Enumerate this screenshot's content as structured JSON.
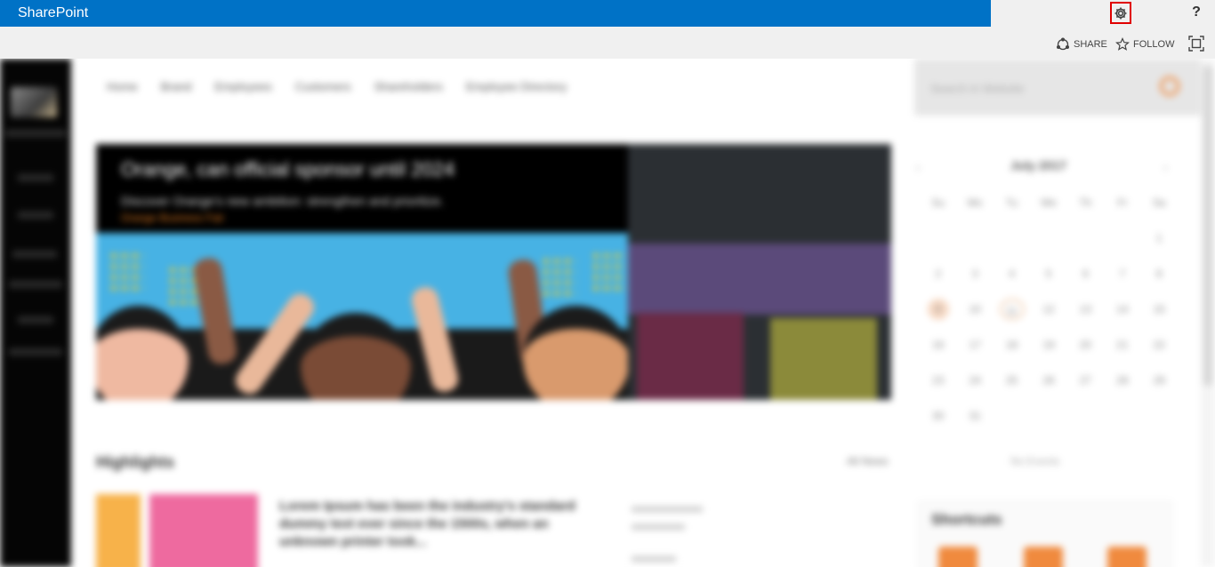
{
  "suite_bar": {
    "brand": "SharePoint",
    "help_label": "?"
  },
  "ribbon": {
    "share_label": "SHARE",
    "follow_label": "FOLLOW"
  },
  "nav": {
    "items": [
      "Home",
      "Brand",
      "Employees",
      "Customers",
      "Shareholders",
      "Employee Directory"
    ]
  },
  "hero": {
    "title": "Orange, can official sponsor until 2024",
    "subtitle": "Discover Orange's new ambition: strengthen and prioritize.",
    "link": "Orange Business Fair"
  },
  "highlights": {
    "title": "Highlights",
    "all_news": "All News",
    "card_text": "Lorem Ipsum has been the industry's standard dummy text ever since the 1500s, when an unknown printer took..."
  },
  "search": {
    "placeholder": "Search in Website"
  },
  "calendar": {
    "month": "July 2017",
    "weekdays": [
      "Su",
      "Mo",
      "Tu",
      "We",
      "Th",
      "Fr",
      "Sa"
    ],
    "days": [
      "",
      "",
      "",
      "",
      "",
      "",
      "1",
      "2",
      "3",
      "4",
      "5",
      "6",
      "7",
      "8",
      "9",
      "10",
      "11",
      "12",
      "13",
      "14",
      "15",
      "16",
      "17",
      "18",
      "19",
      "20",
      "21",
      "22",
      "23",
      "24",
      "25",
      "26",
      "27",
      "28",
      "29",
      "30",
      "31",
      "",
      "",
      "",
      "",
      ""
    ],
    "no_events": "No Events"
  },
  "shortcuts": {
    "title": "Shortcuts"
  },
  "colors": {
    "brand_blue": "#0072c6",
    "accent_orange": "#f08a3e",
    "highlight_red": "#e00000"
  },
  "icons": {
    "settings": "gear-icon",
    "share": "share-icon",
    "follow": "star-icon",
    "focus": "focus-icon"
  }
}
